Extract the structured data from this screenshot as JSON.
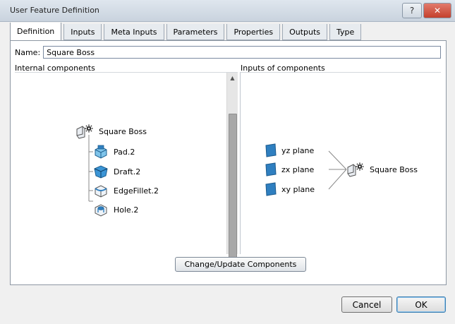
{
  "window": {
    "title": "User Feature Definition",
    "help_label": "?",
    "close_label": "✕"
  },
  "tabs": [
    {
      "label": "Definition",
      "active": true
    },
    {
      "label": "Inputs"
    },
    {
      "label": "Meta Inputs"
    },
    {
      "label": "Parameters"
    },
    {
      "label": "Properties"
    },
    {
      "label": "Outputs"
    },
    {
      "label": "Type"
    }
  ],
  "definition": {
    "name_label": "Name:",
    "name_value": "Square Boss",
    "internal_label": "Internal components",
    "inputs_label": "Inputs of components",
    "tree": {
      "root": {
        "label": "Square Boss",
        "icon": "user-feature-gear-icon"
      },
      "children": [
        {
          "label": "Pad.2",
          "icon": "pad-feature-icon"
        },
        {
          "label": "Draft.2",
          "icon": "draft-feature-icon"
        },
        {
          "label": "EdgeFillet.2",
          "icon": "edge-fillet-icon"
        },
        {
          "label": "Hole.2",
          "icon": "hole-feature-icon"
        }
      ]
    },
    "inputs": [
      {
        "label": "yz plane",
        "icon": "plane-icon"
      },
      {
        "label": "zx plane",
        "icon": "plane-icon"
      },
      {
        "label": "xy plane",
        "icon": "plane-icon"
      }
    ],
    "inputs_target": "Square Boss",
    "change_button": "Change/Update Components"
  },
  "buttons": {
    "ok": "OK",
    "cancel": "Cancel"
  },
  "colors": {
    "plane_blue": "#2f7fc0",
    "close_red": "#c4402c",
    "focus_blue": "#3c7fb1"
  }
}
